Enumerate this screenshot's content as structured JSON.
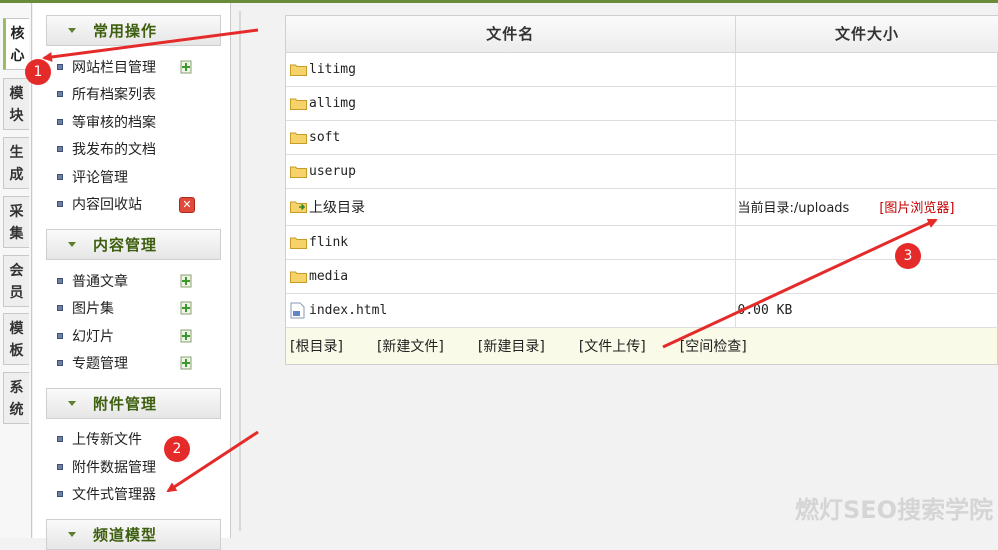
{
  "sidebar_tabs": [
    {
      "label": "核心",
      "active": true
    },
    {
      "label": "模块"
    },
    {
      "label": "生成"
    },
    {
      "label": "采集"
    },
    {
      "label": "会员"
    },
    {
      "label": "模板"
    },
    {
      "label": "系统"
    }
  ],
  "menu": {
    "sections": [
      {
        "title": "常用操作",
        "items": [
          "网站栏目管理",
          "所有档案列表",
          "等审核的档案",
          "我发布的文档",
          "评论管理",
          "内容回收站"
        ]
      },
      {
        "title": "内容管理",
        "items": [
          "普通文章",
          "图片集",
          "幻灯片",
          "专题管理"
        ]
      },
      {
        "title": "附件管理",
        "items": [
          "上传新文件",
          "附件数据管理",
          "文件式管理器"
        ]
      },
      {
        "title": "频道模型",
        "items": []
      }
    ]
  },
  "file_table": {
    "headers": [
      "文件名",
      "文件大小"
    ],
    "rows": [
      {
        "name": "litimg",
        "type": "folder",
        "size": ""
      },
      {
        "name": "allimg",
        "type": "folder",
        "size": ""
      },
      {
        "name": "soft",
        "type": "folder",
        "size": ""
      },
      {
        "name": "userup",
        "type": "folder",
        "size": ""
      },
      {
        "name": "上级目录",
        "type": "parent",
        "size": ""
      },
      {
        "name": "flink",
        "type": "folder",
        "size": ""
      },
      {
        "name": "media",
        "type": "folder",
        "size": ""
      },
      {
        "name": "index.html",
        "type": "file",
        "size": "0.00 KB"
      }
    ],
    "current_dir": "当前目录:/uploads",
    "image_browser": "[图片浏览器]"
  },
  "bottom_links": [
    "[根目录]",
    "[新建文件]",
    "[新建目录]",
    "[文件上传]",
    "[空间检查]"
  ],
  "annotations": {
    "markers": [
      "1",
      "2",
      "3"
    ],
    "color": "#e52a2a"
  },
  "watermark": "燃灯SEO搜索学院"
}
